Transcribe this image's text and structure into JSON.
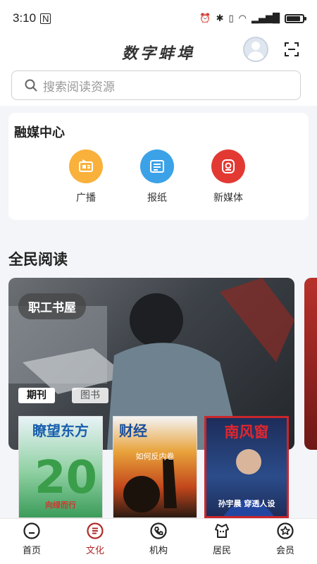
{
  "status": {
    "time": "3:10",
    "nfc": "N"
  },
  "header": {
    "title": "数字蚌埠"
  },
  "search": {
    "placeholder": "搜索阅读资源"
  },
  "media_center": {
    "title": "融媒中心",
    "items": [
      {
        "label": "广播",
        "icon": "radio-icon",
        "color": "#f9b13b"
      },
      {
        "label": "报纸",
        "icon": "newspaper-icon",
        "color": "#3ba2e8"
      },
      {
        "label": "新媒体",
        "icon": "new-media-icon",
        "color": "#e23a33"
      }
    ]
  },
  "reading": {
    "title": "全民阅读",
    "banner_badge": "职工书屋",
    "tabs": [
      "期刊",
      "图书"
    ],
    "magazines": [
      {
        "title": "瞭望东方",
        "subtitle": "向绿而行"
      },
      {
        "title": "财经",
        "subtitle": "如何反内卷"
      },
      {
        "title": "南风窗",
        "subtitle": "孙宇晨 穿透人设"
      }
    ]
  },
  "tabbar": [
    {
      "label": "首页",
      "icon": "home-icon"
    },
    {
      "label": "文化",
      "icon": "culture-icon",
      "active": true
    },
    {
      "label": "机构",
      "icon": "institution-icon"
    },
    {
      "label": "居民",
      "icon": "resident-icon"
    },
    {
      "label": "会员",
      "icon": "member-icon"
    }
  ],
  "colors": {
    "accent": "#b02a2a"
  }
}
